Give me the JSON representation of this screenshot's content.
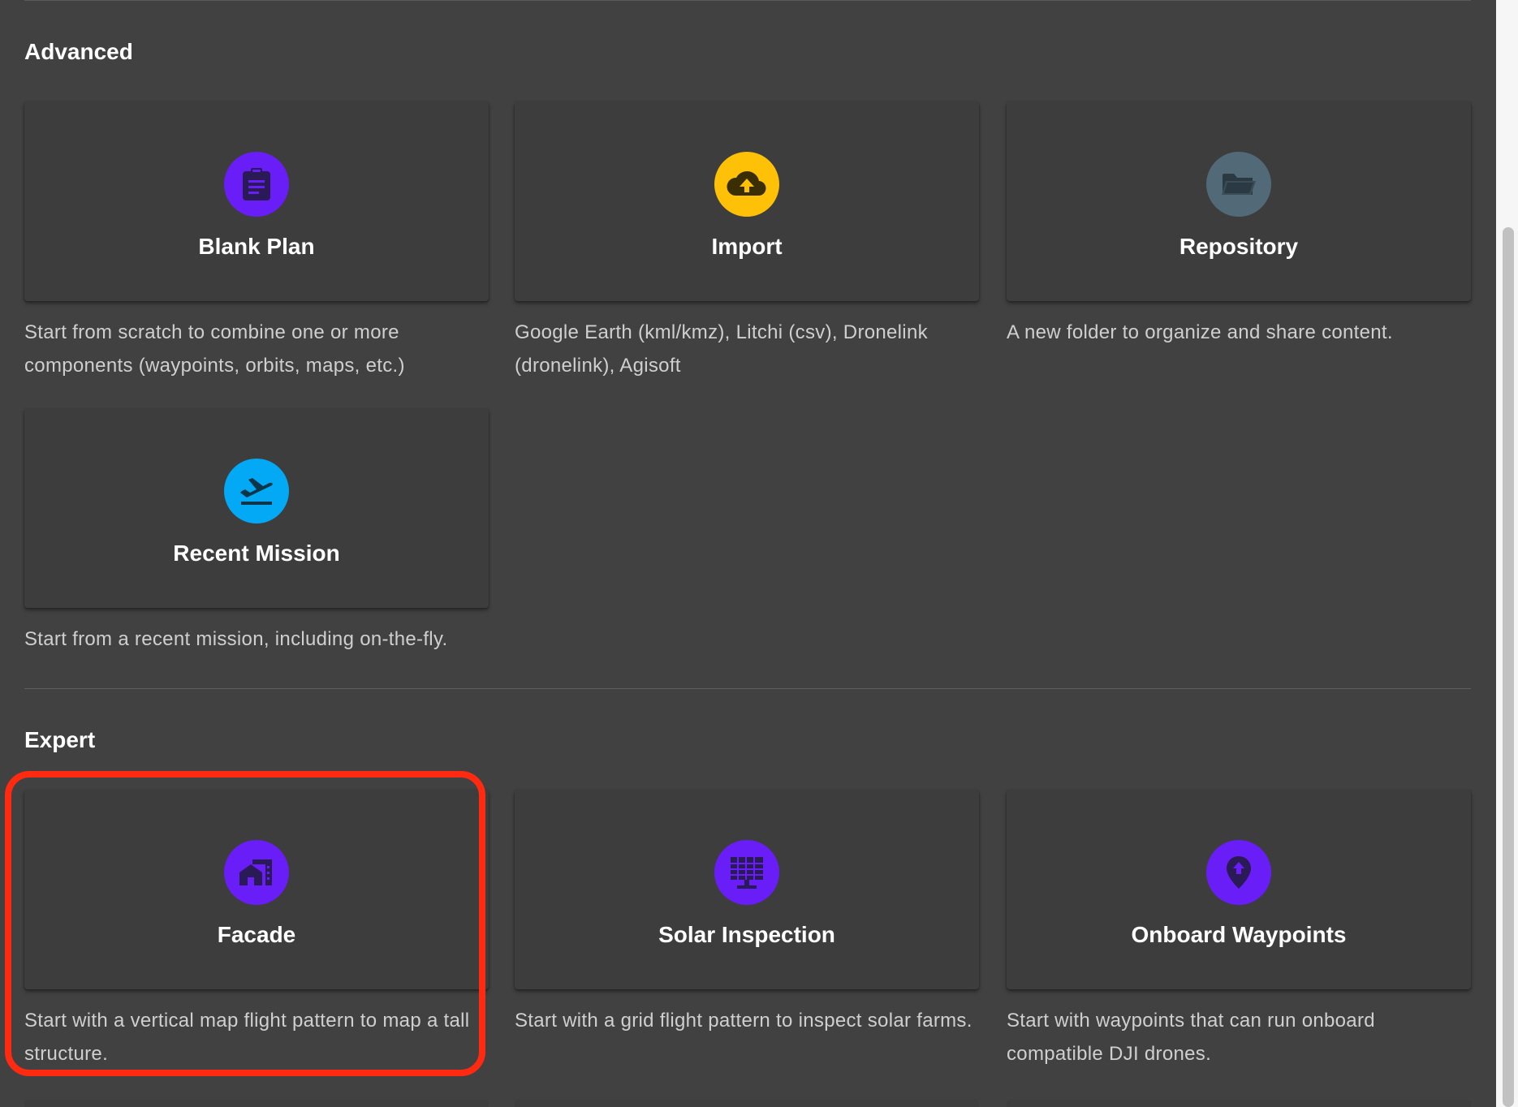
{
  "sections": {
    "advanced": {
      "title": "Advanced",
      "cards": [
        {
          "title": "Blank Plan",
          "description": "Start from scratch to combine one or more components (waypoints, orbits, maps, etc.)",
          "icon": "clipboard-icon",
          "color": "#6a1ef7"
        },
        {
          "title": "Import",
          "description": "Google Earth (kml/kmz), Litchi (csv), Dronelink (dronelink), Agisoft",
          "icon": "cloud-upload-icon",
          "color": "#ffc107"
        },
        {
          "title": "Repository",
          "description": "A new folder to organize and share content.",
          "icon": "folder-open-icon",
          "color": "#526a78"
        },
        {
          "title": "Recent Mission",
          "description": "Start from a recent mission, including on-the-fly.",
          "icon": "flight-takeoff-icon",
          "color": "#03a9f4"
        }
      ]
    },
    "expert": {
      "title": "Expert",
      "cards": [
        {
          "title": "Facade",
          "description": "Start with a vertical map flight pattern to map a tall structure.",
          "icon": "buildings-icon",
          "color": "#6a1ef7"
        },
        {
          "title": "Solar Inspection",
          "description": "Start with a grid flight pattern to inspect solar farms.",
          "icon": "solar-panel-icon",
          "color": "#6a1ef7"
        },
        {
          "title": "Onboard Waypoints",
          "description": "Start with waypoints that can run onboard compatible DJI drones.",
          "icon": "map-pin-icon",
          "color": "#6a1ef7"
        }
      ]
    }
  },
  "highlight_color": "#ff2a10"
}
